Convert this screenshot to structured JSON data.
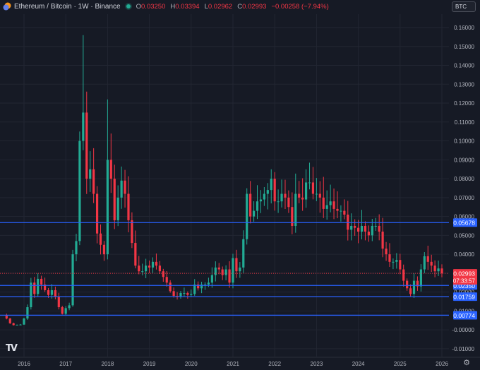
{
  "header": {
    "title": "Ethereum / Bitcoin · 1W · Binance",
    "open_label": "O",
    "open": "0.03250",
    "high_label": "H",
    "high": "0.03394",
    "low_label": "L",
    "low": "0.02962",
    "close_label": "C",
    "close": "0.02993",
    "change": "−0.00258 (−7.94%)"
  },
  "currency_button": "BTC",
  "current_price": {
    "value": "0.02993",
    "countdown": "07:33:57"
  },
  "horizontal_lines": [
    {
      "value": 0.05678,
      "label": "0.05678"
    },
    {
      "value": 0.0235,
      "label": "0.02350"
    },
    {
      "value": 0.01759,
      "label": "0.01759"
    },
    {
      "value": 0.00774,
      "label": "0.00774"
    }
  ],
  "colors": {
    "bg": "#161a25",
    "grid": "#222632",
    "up": "#22ab94",
    "down": "#f23645",
    "line": "#2962ff",
    "text": "#b2b5be"
  },
  "chart_data": {
    "type": "candlestick",
    "title": "Ethereum / Bitcoin · 1W · Binance",
    "start": 2015.583,
    "step_months": 1,
    "closes": [
      0.006,
      0.0035,
      0.0025,
      0.0027,
      0.0028,
      0.006,
      0.012,
      0.025,
      0.019,
      0.027,
      0.024,
      0.021,
      0.0185,
      0.021,
      0.0175,
      0.012,
      0.0085,
      0.0115,
      0.013,
      0.04,
      0.047,
      0.1,
      0.115,
      0.08,
      0.085,
      0.072,
      0.051,
      0.045,
      0.04,
      0.09,
      0.08,
      0.058,
      0.07,
      0.079,
      0.072,
      0.058,
      0.046,
      0.034,
      0.031,
      0.031,
      0.034,
      0.033,
      0.036,
      0.034,
      0.031,
      0.028,
      0.025,
      0.0205,
      0.018,
      0.0175,
      0.0195,
      0.0195,
      0.0185,
      0.019,
      0.024,
      0.022,
      0.024,
      0.024,
      0.025,
      0.029,
      0.033,
      0.032,
      0.029,
      0.032,
      0.025,
      0.038,
      0.031,
      0.033,
      0.048,
      0.072,
      0.06,
      0.063,
      0.068,
      0.069,
      0.072,
      0.074,
      0.08,
      0.068,
      0.068,
      0.072,
      0.07,
      0.065,
      0.055,
      0.072,
      0.07,
      0.069,
      0.078,
      0.078,
      0.072,
      0.072,
      0.07,
      0.064,
      0.066,
      0.068,
      0.064,
      0.063,
      0.063,
      0.061,
      0.053,
      0.055,
      0.054,
      0.052,
      0.055,
      0.052,
      0.05,
      0.055,
      0.055,
      0.052,
      0.043,
      0.04,
      0.036,
      0.036,
      0.037,
      0.032,
      0.026,
      0.022,
      0.019,
      0.026,
      0.023,
      0.032,
      0.039,
      0.036,
      0.034,
      0.031,
      0.0325,
      0.02993
    ],
    "peak_highs": {
      "2017.42": 0.156,
      "2018.0": 0.122,
      "2022.75": 0.085
    },
    "yticks": [
      "0.16000",
      "0.15000",
      "0.14000",
      "0.13000",
      "0.12000",
      "0.11000",
      "0.10000",
      "0.09000",
      "0.08000",
      "0.07000",
      "0.06000",
      "0.05000",
      "0.04000",
      "0.03000",
      "0.02000",
      "0.01000",
      "-0.00000",
      "-0.01000"
    ],
    "ylim": [
      -0.01,
      0.16
    ],
    "xticks": [
      "2016",
      "2017",
      "2018",
      "2019",
      "2020",
      "2021",
      "2022",
      "2023",
      "2024",
      "2025",
      "2026"
    ],
    "grid": true
  }
}
